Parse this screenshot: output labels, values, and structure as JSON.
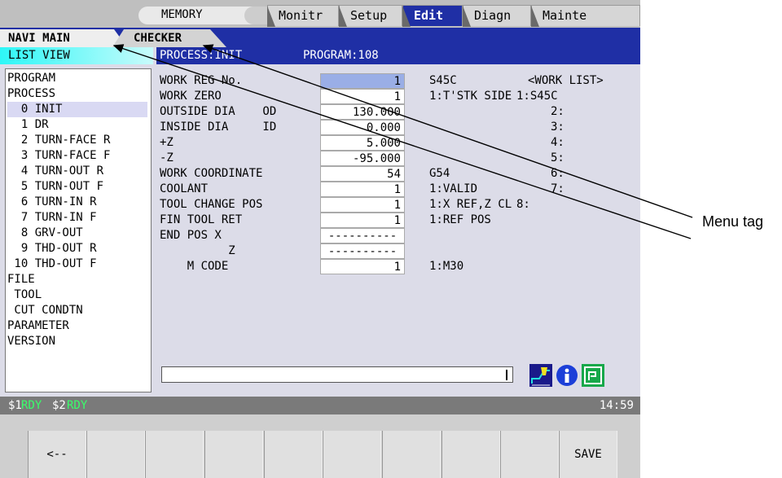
{
  "top": {
    "mode": "MEMORY",
    "tabs": [
      {
        "label": "Monitr",
        "active": false
      },
      {
        "label": "Setup",
        "active": false
      },
      {
        "label": "Edit",
        "active": true
      },
      {
        "label": "Diagn",
        "active": false
      },
      {
        "label": "Mainte",
        "active": false
      }
    ]
  },
  "menu_tabs": {
    "navi_main": "NAVI MAIN",
    "checker": "CHECKER"
  },
  "list": {
    "header": "LIST VIEW",
    "items": [
      "PROGRAM",
      "PROCESS",
      "  0 INIT",
      "  1 DR",
      "  2 TURN-FACE R",
      "  3 TURN-FACE F",
      "  4 TURN-OUT R",
      "  5 TURN-OUT F",
      "  6 TURN-IN R",
      "  7 TURN-IN F",
      "  8 GRV-OUT",
      "  9 THD-OUT R",
      " 10 THD-OUT F",
      "FILE",
      " TOOL",
      " CUT CONDTN",
      "PARAMETER",
      "VERSION"
    ],
    "selected_index": 2
  },
  "main": {
    "process": "PROCESS:INIT",
    "program": "PROGRAM:108",
    "fields": [
      {
        "label": "WORK REG No.",
        "value": "1",
        "note": "S45C"
      },
      {
        "label": "WORK ZERO",
        "value": "1",
        "note": "1:T'STK SIDE"
      },
      {
        "label": "OUTSIDE DIA    OD",
        "value": "130.000",
        "note": ""
      },
      {
        "label": "INSIDE DIA     ID",
        "value": "0.000",
        "note": ""
      },
      {
        "label": "+Z",
        "value": "5.000",
        "note": ""
      },
      {
        "label": "-Z",
        "value": "-95.000",
        "note": ""
      },
      {
        "label": "WORK COORDINATE",
        "value": "54",
        "note": "G54"
      },
      {
        "label": "COOLANT",
        "value": "1",
        "note": "1:VALID"
      },
      {
        "label": "TOOL CHANGE POS",
        "value": "1",
        "note": "1:X REF,Z CL"
      },
      {
        "label": "FIN TOOL RET",
        "value": "1",
        "note": "1:REF POS"
      },
      {
        "label": "END POS X",
        "value": "----------",
        "note": ""
      },
      {
        "label": "          Z",
        "value": "----------",
        "note": ""
      },
      {
        "label": "    M CODE",
        "value": "1",
        "note": "1:M30"
      }
    ],
    "work_list": {
      "title": "<WORK LIST>",
      "items": [
        "1:S45C",
        "2:",
        "3:",
        "4:",
        "5:",
        "6:",
        "7:",
        "8:"
      ]
    }
  },
  "status": {
    "s1": "$1",
    "s1_state": "RDY",
    "s2": "$2",
    "s2_state": "RDY",
    "time": "14:59"
  },
  "softkeys": [
    "<--",
    "",
    "",
    "",
    "",
    "",
    "",
    "",
    "",
    "SAVE"
  ],
  "annotation": "Menu tag",
  "icons": [
    "tool-path-icon",
    "info-icon",
    "program-icon"
  ]
}
